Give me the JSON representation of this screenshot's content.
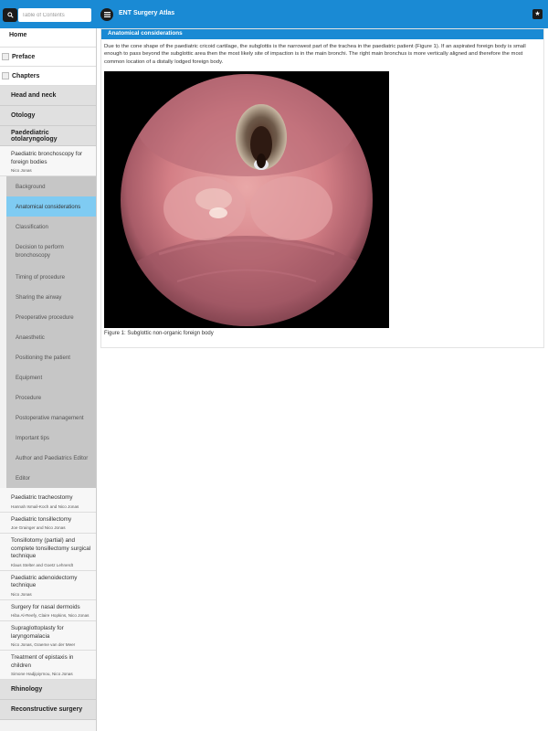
{
  "topbar": {
    "search_placeholder": "Table of Contents",
    "app_title": "ENT Surgery Atlas",
    "colors": {
      "bar": "#1a8ad4",
      "button": "#1b1b1b"
    }
  },
  "sidebar": {
    "home": "Home",
    "preface": "Preface",
    "chapters": "Chapters",
    "sections": [
      "Head and neck",
      "Otology",
      "Paedediatric otolaryngology"
    ],
    "current_article": {
      "title": "Paediatric bronchoscopy for foreign bodies",
      "author": "Nico Jonas"
    },
    "subsections": [
      "Background",
      "Anatomical considerations",
      "Classification",
      "Decision to perform bronchoscopy",
      "Timing of procedure",
      "Sharing the airway",
      "Preoperative procedure",
      "Anaesthetic",
      "Positioning the patient",
      "Equipment",
      "Procedure",
      "Postoperative management",
      "Important tips",
      "Author and Paediatrics Editor",
      "Editor"
    ],
    "active_subsection": "Anatomical considerations",
    "articles": [
      {
        "title": "Paediatric tracheostomy",
        "author": "Hannah Ismail-Koch and Nico Jonas"
      },
      {
        "title": "Paediatric tonsillectomy",
        "author": "Joe Grainger and Nico Jonas"
      },
      {
        "title": "Tonsillotomy (partial) and complete tonsillectomy surgical technique",
        "author": "Klaus Stelter and Goetz Lehnerdt"
      },
      {
        "title": "Paediatric adenoidectomy technique",
        "author": "Nico Jonas"
      },
      {
        "title": "Surgery for nasal dermoids",
        "author": "Hiba Al-Reefy, Claire Hopkins, Nico Jonas"
      },
      {
        "title": "Supraglottoplasty for laryngomalacia",
        "author": "Nico Jonas, Graeme van der Meer"
      },
      {
        "title": "Treatment of epistaxis in children",
        "author": "Simone Hadjipiyrnou, Nico Jonas"
      }
    ],
    "bottom_sections": [
      "Rhinology",
      "Reconstructive surgery"
    ]
  },
  "main": {
    "section_title": "Anatomical considerations",
    "paragraph": "Due to the cone shape of the paediatric cricoid cartilage, the subglottis is the narrowest part of the trachea in the paediatric patient (Figure 1). If an aspirated foreign body is small enough to pass beyond the subglottic area then the most likely site of impaction is in the main bronchi. The right main bronchus is more vertically aligned and therefore the most common location of a distally lodged foreign body.",
    "figure_caption": "Figure 1: Subglottic non-organic foreign body"
  }
}
